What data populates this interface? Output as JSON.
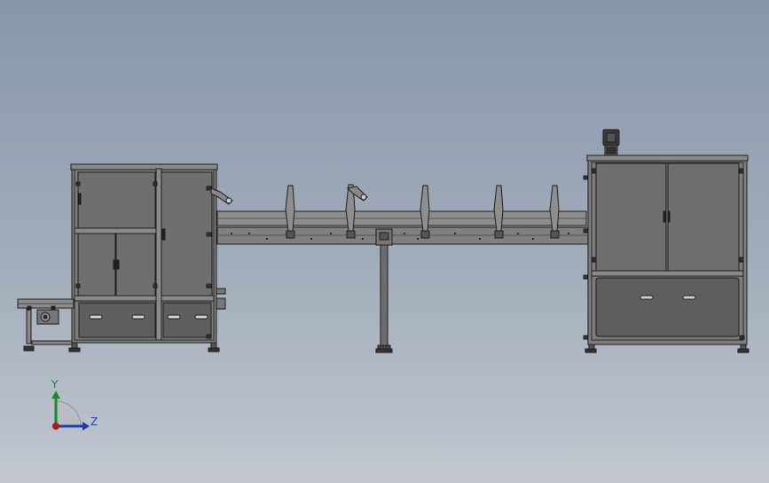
{
  "axes": {
    "y_label": "Y",
    "z_label": "Z"
  },
  "colors": {
    "frame": "#7f7f7f",
    "frame_dark": "#3c3c3c",
    "panel": "#6e6e6e",
    "panel_light": "#8a8a8a",
    "outline": "#1e1e1e",
    "y_axis": "#1b8a2c",
    "z_axis": "#1f3fa8",
    "x_axis": "#b01818"
  }
}
